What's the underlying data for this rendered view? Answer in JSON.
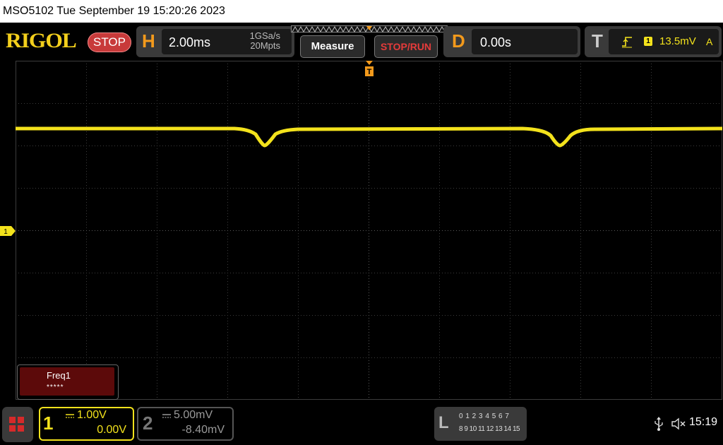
{
  "title_bar": {
    "text": "MSO5102  Tue September 19 15:20:26 2023"
  },
  "header": {
    "logo": "RIGOL",
    "run_state": "STOP",
    "horizontal": {
      "letter": "H",
      "timebase": "2.00ms",
      "sample_rate": "1GSa/s",
      "memory_depth": "20Mpts"
    },
    "measure_label": "Measure",
    "stoprun_label": "STOP/RUN",
    "delay": {
      "letter": "D",
      "value": "0.00s"
    },
    "trigger": {
      "letter": "T",
      "channel": "1",
      "level": "13.5mV",
      "mode": "A",
      "edge_icon": "rising-edge-icon"
    }
  },
  "screen": {
    "ch1_marker_label": "1",
    "trigger_marker_label": "T",
    "measurement": {
      "name": "Freq1",
      "value": "*****"
    }
  },
  "footer": {
    "menu_icon": "grid-menu-icon",
    "ch1": {
      "number": "1",
      "scale": "1.00V",
      "offset": "0.00V"
    },
    "ch2": {
      "number": "2",
      "scale": "5.00mV",
      "offset": "-8.40mV"
    },
    "logic": {
      "letter": "L",
      "row1": "0 1 2 3  4 5 6 7",
      "row2": "8 9 10 11 12 13 14 15"
    },
    "usb_icon": "usb-icon",
    "sound_icon": "speaker-muted-icon",
    "clock": "15:19"
  },
  "colors": {
    "ch1": "#f3e21c",
    "accent": "#f39a1c",
    "stop": "#c83a3a",
    "measure_bg": "#5c0a0a"
  }
}
